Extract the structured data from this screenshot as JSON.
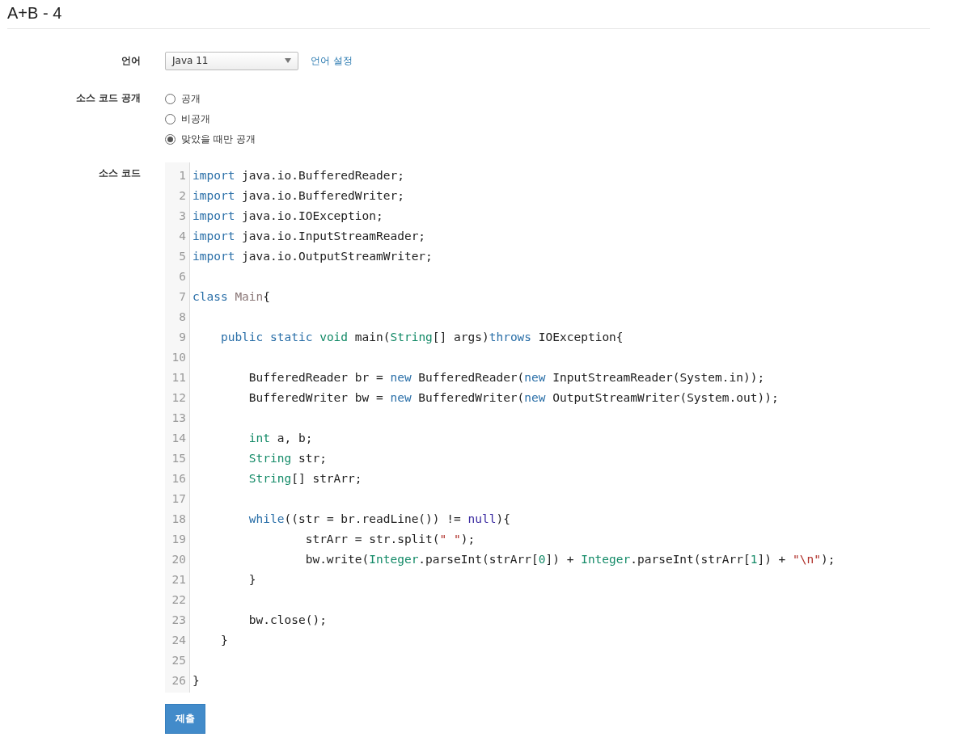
{
  "title": "A+B - 4",
  "language": {
    "label": "언어",
    "value": "Java 11",
    "settings_link": "언어 설정"
  },
  "visibility": {
    "label": "소스 코드 공개",
    "options": [
      {
        "label": "공개",
        "selected": false
      },
      {
        "label": "비공개",
        "selected": false
      },
      {
        "label": "맞았을 때만 공개",
        "selected": true
      }
    ]
  },
  "source": {
    "label": "소스 코드",
    "lines": [
      {
        "number": "1",
        "tokens": [
          {
            "text": "import",
            "kind": "keyword"
          },
          {
            "text": " java.io.BufferedReader;",
            "kind": "plain"
          }
        ]
      },
      {
        "number": "2",
        "tokens": [
          {
            "text": "import",
            "kind": "keyword"
          },
          {
            "text": " java.io.BufferedWriter;",
            "kind": "plain"
          }
        ]
      },
      {
        "number": "3",
        "tokens": [
          {
            "text": "import",
            "kind": "keyword"
          },
          {
            "text": " java.io.IOException;",
            "kind": "plain"
          }
        ]
      },
      {
        "number": "4",
        "tokens": [
          {
            "text": "import",
            "kind": "keyword"
          },
          {
            "text": " java.io.InputStreamReader;",
            "kind": "plain"
          }
        ]
      },
      {
        "number": "5",
        "tokens": [
          {
            "text": "import",
            "kind": "keyword"
          },
          {
            "text": " java.io.OutputStreamWriter;",
            "kind": "plain"
          }
        ]
      },
      {
        "number": "6"
      },
      {
        "number": "7",
        "tokens": [
          {
            "text": "class",
            "kind": "keyword"
          },
          {
            "text": " Main",
            "kind": "def"
          },
          {
            "text": "{",
            "kind": "plain"
          }
        ]
      },
      {
        "number": "8"
      },
      {
        "number": "9",
        "tokens": [
          {
            "text": "    public",
            "kind": "keyword"
          },
          {
            "text": " static",
            "kind": "keyword"
          },
          {
            "text": " void",
            "kind": "type"
          },
          {
            "text": " main(",
            "kind": "plain"
          },
          {
            "text": "String",
            "kind": "type"
          },
          {
            "text": "[] args)",
            "kind": "plain"
          },
          {
            "text": "throws",
            "kind": "keyword"
          },
          {
            "text": " IOException{",
            "kind": "plain"
          }
        ]
      },
      {
        "number": "10"
      },
      {
        "number": "11",
        "tokens": [
          {
            "text": "        BufferedReader br = ",
            "kind": "plain"
          },
          {
            "text": "new",
            "kind": "keyword"
          },
          {
            "text": " BufferedReader(",
            "kind": "plain"
          },
          {
            "text": "new",
            "kind": "keyword"
          },
          {
            "text": " InputStreamReader(System.in));",
            "kind": "plain"
          }
        ]
      },
      {
        "number": "12",
        "tokens": [
          {
            "text": "        BufferedWriter bw = ",
            "kind": "plain"
          },
          {
            "text": "new",
            "kind": "keyword"
          },
          {
            "text": " BufferedWriter(",
            "kind": "plain"
          },
          {
            "text": "new",
            "kind": "keyword"
          },
          {
            "text": " OutputStreamWriter(System.out));",
            "kind": "plain"
          }
        ]
      },
      {
        "number": "13"
      },
      {
        "number": "14",
        "tokens": [
          {
            "text": "        int",
            "kind": "type"
          },
          {
            "text": " a, b;",
            "kind": "plain"
          }
        ]
      },
      {
        "number": "15",
        "tokens": [
          {
            "text": "        String",
            "kind": "type"
          },
          {
            "text": " str;",
            "kind": "plain"
          }
        ]
      },
      {
        "number": "16",
        "tokens": [
          {
            "text": "        String",
            "kind": "type"
          },
          {
            "text": "[] strArr;",
            "kind": "plain"
          }
        ]
      },
      {
        "number": "17"
      },
      {
        "number": "18",
        "tokens": [
          {
            "text": "        while",
            "kind": "keyword"
          },
          {
            "text": "((str = br.readLine()) != ",
            "kind": "plain"
          },
          {
            "text": "null",
            "kind": "atom"
          },
          {
            "text": "){",
            "kind": "plain"
          }
        ]
      },
      {
        "number": "19",
        "tokens": [
          {
            "text": "                strArr = str.split(",
            "kind": "plain"
          },
          {
            "text": "\" \"",
            "kind": "string"
          },
          {
            "text": ");",
            "kind": "plain"
          }
        ]
      },
      {
        "number": "20",
        "tokens": [
          {
            "text": "                bw.write(",
            "kind": "plain"
          },
          {
            "text": "Integer",
            "kind": "type"
          },
          {
            "text": ".parseInt(strArr[",
            "kind": "plain"
          },
          {
            "text": "0",
            "kind": "number"
          },
          {
            "text": "]) + ",
            "kind": "plain"
          },
          {
            "text": "Integer",
            "kind": "type"
          },
          {
            "text": ".parseInt(strArr[",
            "kind": "plain"
          },
          {
            "text": "1",
            "kind": "number"
          },
          {
            "text": "]) + ",
            "kind": "plain"
          },
          {
            "text": "\"\\n\"",
            "kind": "string"
          },
          {
            "text": ");",
            "kind": "plain"
          }
        ]
      },
      {
        "number": "21",
        "tokens": [
          {
            "text": "        }",
            "kind": "plain"
          }
        ]
      },
      {
        "number": "22"
      },
      {
        "number": "23",
        "tokens": [
          {
            "text": "        bw.close();",
            "kind": "plain"
          }
        ]
      },
      {
        "number": "24",
        "tokens": [
          {
            "text": "    }",
            "kind": "plain"
          }
        ]
      },
      {
        "number": "25"
      },
      {
        "number": "26",
        "tokens": [
          {
            "text": "}",
            "kind": "plain"
          }
        ]
      }
    ]
  },
  "submit": "제출"
}
